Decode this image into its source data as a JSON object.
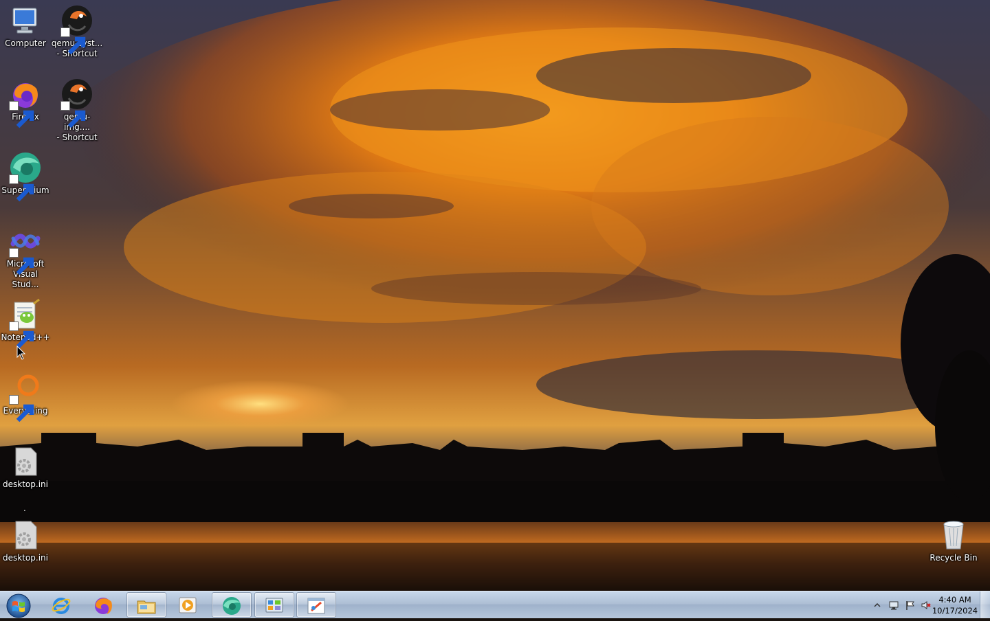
{
  "desktop": {
    "icons": [
      {
        "label": "Computer",
        "icon": "computer-icon"
      },
      {
        "label": "qemu-syst...\n- Shortcut",
        "icon": "qemu-icon"
      },
      {
        "label": "Firefox",
        "icon": "firefox-icon"
      },
      {
        "label": "qemu-img....\n- Shortcut",
        "icon": "qemu-icon"
      },
      {
        "label": "Supermium",
        "icon": "supermium-icon"
      },
      {
        "label": "Microsoft\nVisual Stud...",
        "icon": "visual-studio-icon"
      },
      {
        "label": "Notepad++",
        "icon": "notepadpp-icon"
      },
      {
        "label": "Everything",
        "icon": "everything-icon"
      },
      {
        "label": "desktop.ini",
        "icon": "settings-file-icon"
      },
      {
        "label": "desktop.ini",
        "icon": "settings-file-icon"
      },
      {
        "label": "Recycle Bin",
        "icon": "recycle-bin-icon"
      }
    ],
    "stray_text": "."
  },
  "taskbar": {
    "start_icon": "windows-start-icon",
    "buttons": [
      {
        "name": "internet-explorer",
        "icon": "internet-explorer-icon",
        "active": false
      },
      {
        "name": "firefox",
        "icon": "firefox-icon",
        "active": false
      },
      {
        "name": "windows-explorer",
        "icon": "folder-icon",
        "active": true
      },
      {
        "name": "media-player",
        "icon": "media-player-icon",
        "active": false
      },
      {
        "name": "supermium",
        "icon": "supermium-icon",
        "active": true
      },
      {
        "name": "control-panel",
        "icon": "control-panel-icon",
        "active": true
      },
      {
        "name": "paint",
        "icon": "paint-icon",
        "active": true
      }
    ],
    "tray": {
      "show_hidden_icon": "chevron-up-icon",
      "icons": [
        "network-icon",
        "action-center-flag-icon",
        "volume-muted-icon"
      ],
      "time": "4:40 AM",
      "date": "10/17/2024"
    }
  },
  "colors": {
    "taskbar_top": "#c7d7ea",
    "taskbar_bottom": "#9fb2cb",
    "sky_orange": "#e8861a",
    "sky_dark": "#2e2d3e"
  }
}
